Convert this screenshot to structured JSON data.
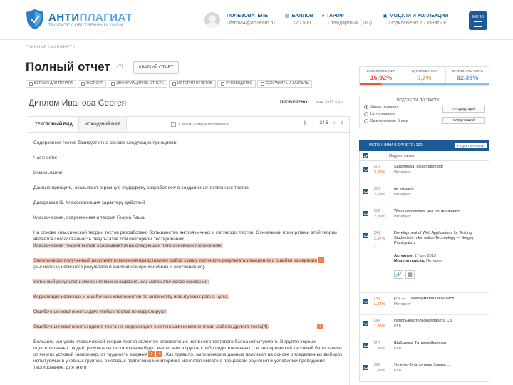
{
  "header": {
    "logo": {
      "name_dark": "АНТИ",
      "name_light": "ПЛАГИАТ",
      "tagline": "ТВОРИТЕ СОБСТВЕННЫМ УМОМ"
    },
    "user": {
      "label": "ПОЛЬЗОВАТЕЛЬ",
      "value": "Ufarma4@ap-team.ru"
    },
    "points": {
      "label": "БАЛЛОВ",
      "value": "120 500"
    },
    "plan": {
      "label": "ТАРИФ",
      "value": "Стандартный (100)"
    },
    "modules": {
      "label": "МОДУЛИ И КОЛЛЕКЦИИ",
      "value": "Подключено 2 · Узнать ▾"
    },
    "menu_label": "МЕНЮ"
  },
  "breadcrumb": "ГЛАВНАЯ  /  КАБИНЕТ  /",
  "page": {
    "title": "Полный отчет",
    "help": "(?)",
    "brief_report": "КРАТКИЙ ОТЧЕТ"
  },
  "toolbar": [
    {
      "label": "ВЕРСИЯ ДЛЯ ПЕЧАТИ",
      "icon": "print-icon"
    },
    {
      "label": "ЭКСПОРТ",
      "icon": "export-icon"
    },
    {
      "label": "ИНФОРМАЦИЯ ОБ ОТЧЕТЕ",
      "icon": "info-icon"
    },
    {
      "label": "ИСТОРИЯ ОТЧЕТОВ",
      "icon": "history-icon"
    },
    {
      "label": "РУКОВОДСТВО",
      "icon": "guide-icon"
    },
    {
      "label": "СОХРАНИТЬ И ЗАКРЫТЬ",
      "icon": "save-icon"
    }
  ],
  "document": {
    "title": "Диплом Иванова Сергея",
    "checked_label": "ПРОВЕРЕНО:",
    "checked_date": "11 мая 2017 года",
    "tabs": [
      "ТЕКСТОВЫЙ ВИД",
      "ИСХОДНЫЙ ВИД"
    ],
    "hide_label": "Скрыть номера источников",
    "pager": {
      "prev_first": "|‹",
      "prev": "‹",
      "page": "2 / 5",
      "next": "›",
      "next_last": "›|"
    },
    "paragraphs": {
      "p1": "Содержание тестов базируется на основе следующих принципов:",
      "p2": "Частности:",
      "p3": "Измельчания.",
      "p4": "Данные принципы оказывают огромную поддержку разработчику в создании качественных тестов.",
      "p5": "Диаграмма I1. Классификация характеру действий",
      "p6": "Классическая, современная и теория Георга Раша",
      "p7": "На основе классической теории тестов разработано большинство англоязычных и латинских тестов. Основными принципами этой теории является согласованность результатов при повторном тестировании.",
      "p7b": "Классическая теория тестов основывается на следующих пяти основных положениях:",
      "p8a": "Эмпирически полученный результат измерения представляет собой сумму истинного результата измерения и ошибки измерения",
      "p8b": " (вычислены истинного результата и ошибки измерений обоих и соотношения).",
      "p9": "Истинный результат измерения можно выразить как математическое ожидание:",
      "p10": "Корреляция истинных и ошибочных компонентов по множеству испытуемых равна нулю.",
      "p11": "Ошибочные компоненты двух любых тестов не коррелируют:",
      "p12": "Ошибочные компоненты одного теста не коррелируют с истинными компонентами любого другого теста[4].",
      "p13a": "Большим минусом классической теории тестов является определение истинного тестового балла испытуемого. В группе хорошо подготовленных людей, результаты тестирования будут выше, чем в группе слабо подготовленных, т.е. эмпирический тестовый балл зависит от многих условий (например, от трудности задания",
      "p13b": ". Как правило, эмпирические данные получают на основе определенных выборок испытуемых в учебных группах, в которых подготовки мониторинга меняется вместе с процессом обучения и условиями проведения тестирования, для этого"
    },
    "markers": [
      "1",
      "2",
      "3",
      "4"
    ]
  },
  "stats": [
    {
      "label": "ЗАИМСТВОВАНИЯ",
      "value": "16,92%",
      "color": "#e0574a"
    },
    {
      "label": "ЦИТИРОВАНИЯ",
      "value": "0,7%",
      "color": "#f09b30"
    },
    {
      "label": "ОРИГИНАЛЬНОСТЬ",
      "value": "82,38%",
      "color": "#5a98d6"
    }
  ],
  "stat_bar": [
    16.92,
    0.7,
    82.38
  ],
  "navigation": {
    "head": "ПОДСВЕТКА ПО ТЕКСТУ",
    "options": [
      "Заимствования",
      "Цитирования",
      "Выключенные блоки"
    ],
    "prev": "ПРЕДЫДУЩИЙ",
    "next": "СЛЕДУЮЩИЙ"
  },
  "sources": {
    "header": "ИСТОЧНИКИ В ОТЧЕТЕ: 100",
    "edit": "РЕДАКТИРОВАТЬ",
    "col_header": "Модули поиска",
    "items": [
      {
        "id": "[01]",
        "pct": "3,05%",
        "name": "Sadchikova_dissertation.pdf",
        "type": "Интернет"
      },
      {
        "id": "[02]",
        "pct": "2,09%",
        "name": "не указано",
        "type": "Интернет"
      },
      {
        "id": "[03]",
        "pct": "2,09%",
        "name": "Web-приложение для тестирования",
        "type": "Интернет"
      },
      {
        "id": "[04]",
        "pct": "2,37%",
        "name": "Development of Web Applications for Testing Students in Information Technology — Sergey Pozdnyakov",
        "type": "",
        "date_label": "Актуален:",
        "date": "17 дек 2015",
        "module_label": "Модуль поиска:",
        "module": "Интернет"
      },
      {
        "id": "[05]",
        "pct": "1,64%",
        "name": "[10] — ... Информатика и вычисл...",
        "type": "Интернет"
      },
      {
        "id": "[06]",
        "pct": "1,38%",
        "name": "Использовательская работа СБ",
        "type": "РГБ"
      },
      {
        "id": "[07]",
        "pct": "1,38%",
        "name": "Шайхиева, Татьяна Иванова",
        "type": "РГБ"
      },
      {
        "id": "[08]",
        "pct": "1,38%",
        "name": "Успенко-Блатфунова Закамс...",
        "type": "РГБ"
      }
    ]
  },
  "colors": {
    "brand": "#1c5a96",
    "highlight": "#f6d8cc",
    "marker": "#ef7e48"
  }
}
